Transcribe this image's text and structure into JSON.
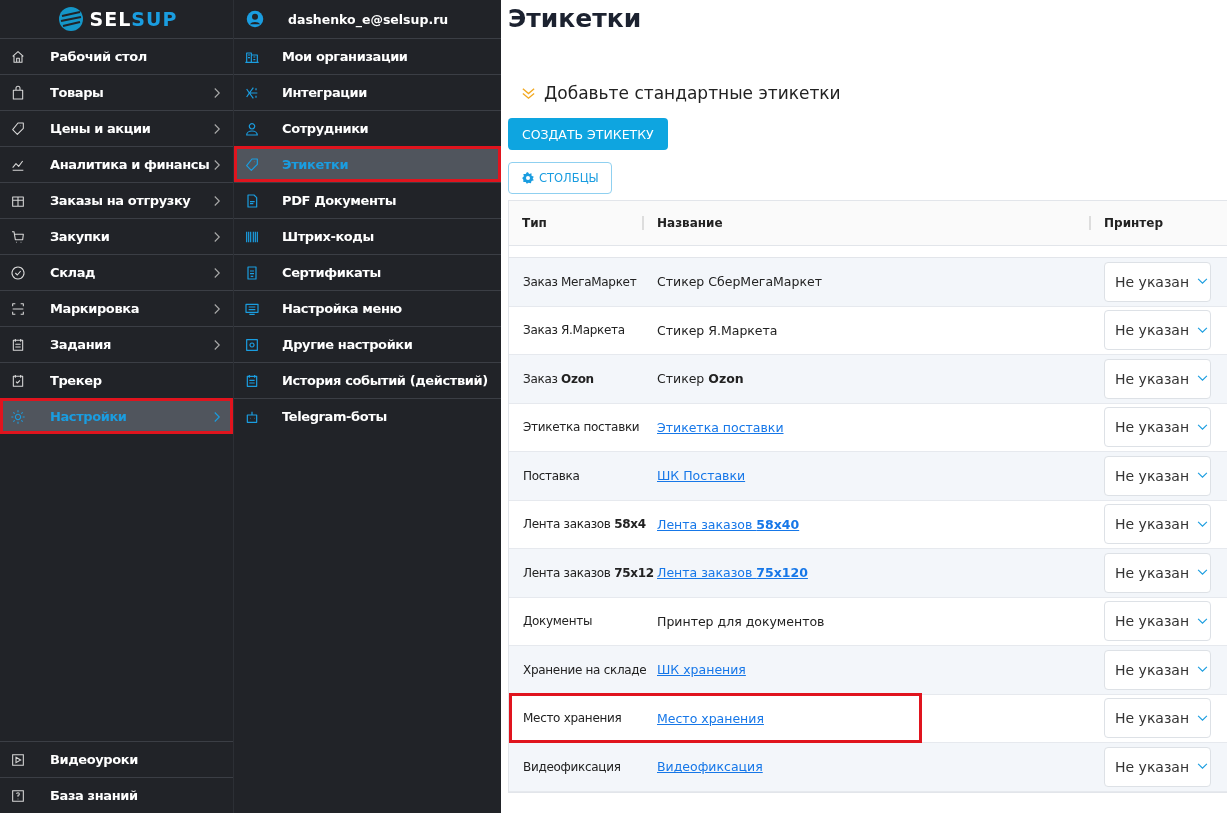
{
  "logo": {
    "part_1": "SEL",
    "part_2": "SUP"
  },
  "sidebar": {
    "items": [
      {
        "label": "Рабочий стол",
        "selected": false,
        "has_submenu": false,
        "annotated": false
      },
      {
        "label": "Товары",
        "selected": false,
        "has_submenu": true,
        "annotated": false
      },
      {
        "label": "Цены и акции",
        "selected": false,
        "has_submenu": true,
        "annotated": false
      },
      {
        "label": "Аналитика и финансы",
        "selected": false,
        "has_submenu": true,
        "annotated": false
      },
      {
        "label": "Заказы на отгрузку",
        "selected": false,
        "has_submenu": true,
        "annotated": false
      },
      {
        "label": "Закупки",
        "selected": false,
        "has_submenu": true,
        "annotated": false
      },
      {
        "label": "Склад",
        "selected": false,
        "has_submenu": true,
        "annotated": false
      },
      {
        "label": "Маркировка",
        "selected": false,
        "has_submenu": true,
        "annotated": false
      },
      {
        "label": "Задания",
        "selected": false,
        "has_submenu": true,
        "annotated": false
      },
      {
        "label": "Трекер",
        "selected": false,
        "has_submenu": false,
        "annotated": false
      },
      {
        "label": "Настройки",
        "selected": true,
        "has_submenu": true,
        "annotated": true
      }
    ],
    "bottom_items": [
      {
        "label": "Видеоуроки"
      },
      {
        "label": "База знаний"
      }
    ]
  },
  "submenu": {
    "user": "dashenko_e@selsup.ru",
    "items": [
      {
        "label": "Мои организации",
        "selected": false,
        "annotated": false
      },
      {
        "label": "Интеграции",
        "selected": false,
        "annotated": false
      },
      {
        "label": "Сотрудники",
        "selected": false,
        "annotated": false
      },
      {
        "label": "Этикетки",
        "selected": true,
        "annotated": true
      },
      {
        "label": "PDF Документы",
        "selected": false,
        "annotated": false
      },
      {
        "label": "Штрих-коды",
        "selected": false,
        "annotated": false
      },
      {
        "label": "Сертификаты",
        "selected": false,
        "annotated": false
      },
      {
        "label": "Настройка меню",
        "selected": false,
        "annotated": false
      },
      {
        "label": "Другие настройки",
        "selected": false,
        "annotated": false
      },
      {
        "label": "История событий (действий)",
        "selected": false,
        "annotated": false
      },
      {
        "label": "Telegram-боты",
        "selected": false,
        "annotated": false
      }
    ]
  },
  "page": {
    "title": "Этикетки",
    "section": "Добавьте стандартные этикетки",
    "create_button": "СОЗДАТЬ ЭТИКЕТКУ",
    "columns_button": "СТОЛБЦЫ"
  },
  "table": {
    "columns": [
      "Тип",
      "Название",
      "Принтер"
    ],
    "rows": [
      {
        "type": "Заказ МегаМаркет",
        "name": "Стикер СберМегаМаркет",
        "kind": "text",
        "printer": "Не указан",
        "annotated": false
      },
      {
        "type": "Заказ Я.Маркета",
        "name": "Стикер Я.Маркета",
        "kind": "text",
        "printer": "Не указан",
        "annotated": false
      },
      {
        "type": "Заказ **Ozon**",
        "name": "Стикер **Ozon**",
        "kind": "text",
        "printer": "Не указан",
        "annotated": false
      },
      {
        "type": "Этикетка поставки",
        "name": "Этикетка поставки",
        "kind": "link",
        "printer": "Не указан",
        "annotated": false
      },
      {
        "type": "Поставка",
        "name": "ШК Поставки",
        "kind": "link",
        "printer": "Не указан",
        "annotated": false
      },
      {
        "type": "Лента заказов **58x4**",
        "name": "Лента заказов **58x40**",
        "kind": "link",
        "printer": "Не указан",
        "annotated": false
      },
      {
        "type": "Лента заказов **75x12**",
        "name": "Лента заказов **75x120**",
        "kind": "link",
        "printer": "Не указан",
        "annotated": false
      },
      {
        "type": "Документы",
        "name": "Принтер для документов",
        "kind": "text",
        "printer": "Не указан",
        "annotated": false
      },
      {
        "type": "Хранение на складе",
        "name": "ШК хранения",
        "kind": "link",
        "printer": "Не указан",
        "annotated": false
      },
      {
        "type": "Место хранения",
        "name": "Место хранения",
        "kind": "link",
        "printer": "Не указан",
        "annotated": true
      },
      {
        "type": "Видеофиксация",
        "name": "Видеофиксация",
        "kind": "link",
        "printer": "Не указан",
        "annotated": false
      }
    ]
  }
}
